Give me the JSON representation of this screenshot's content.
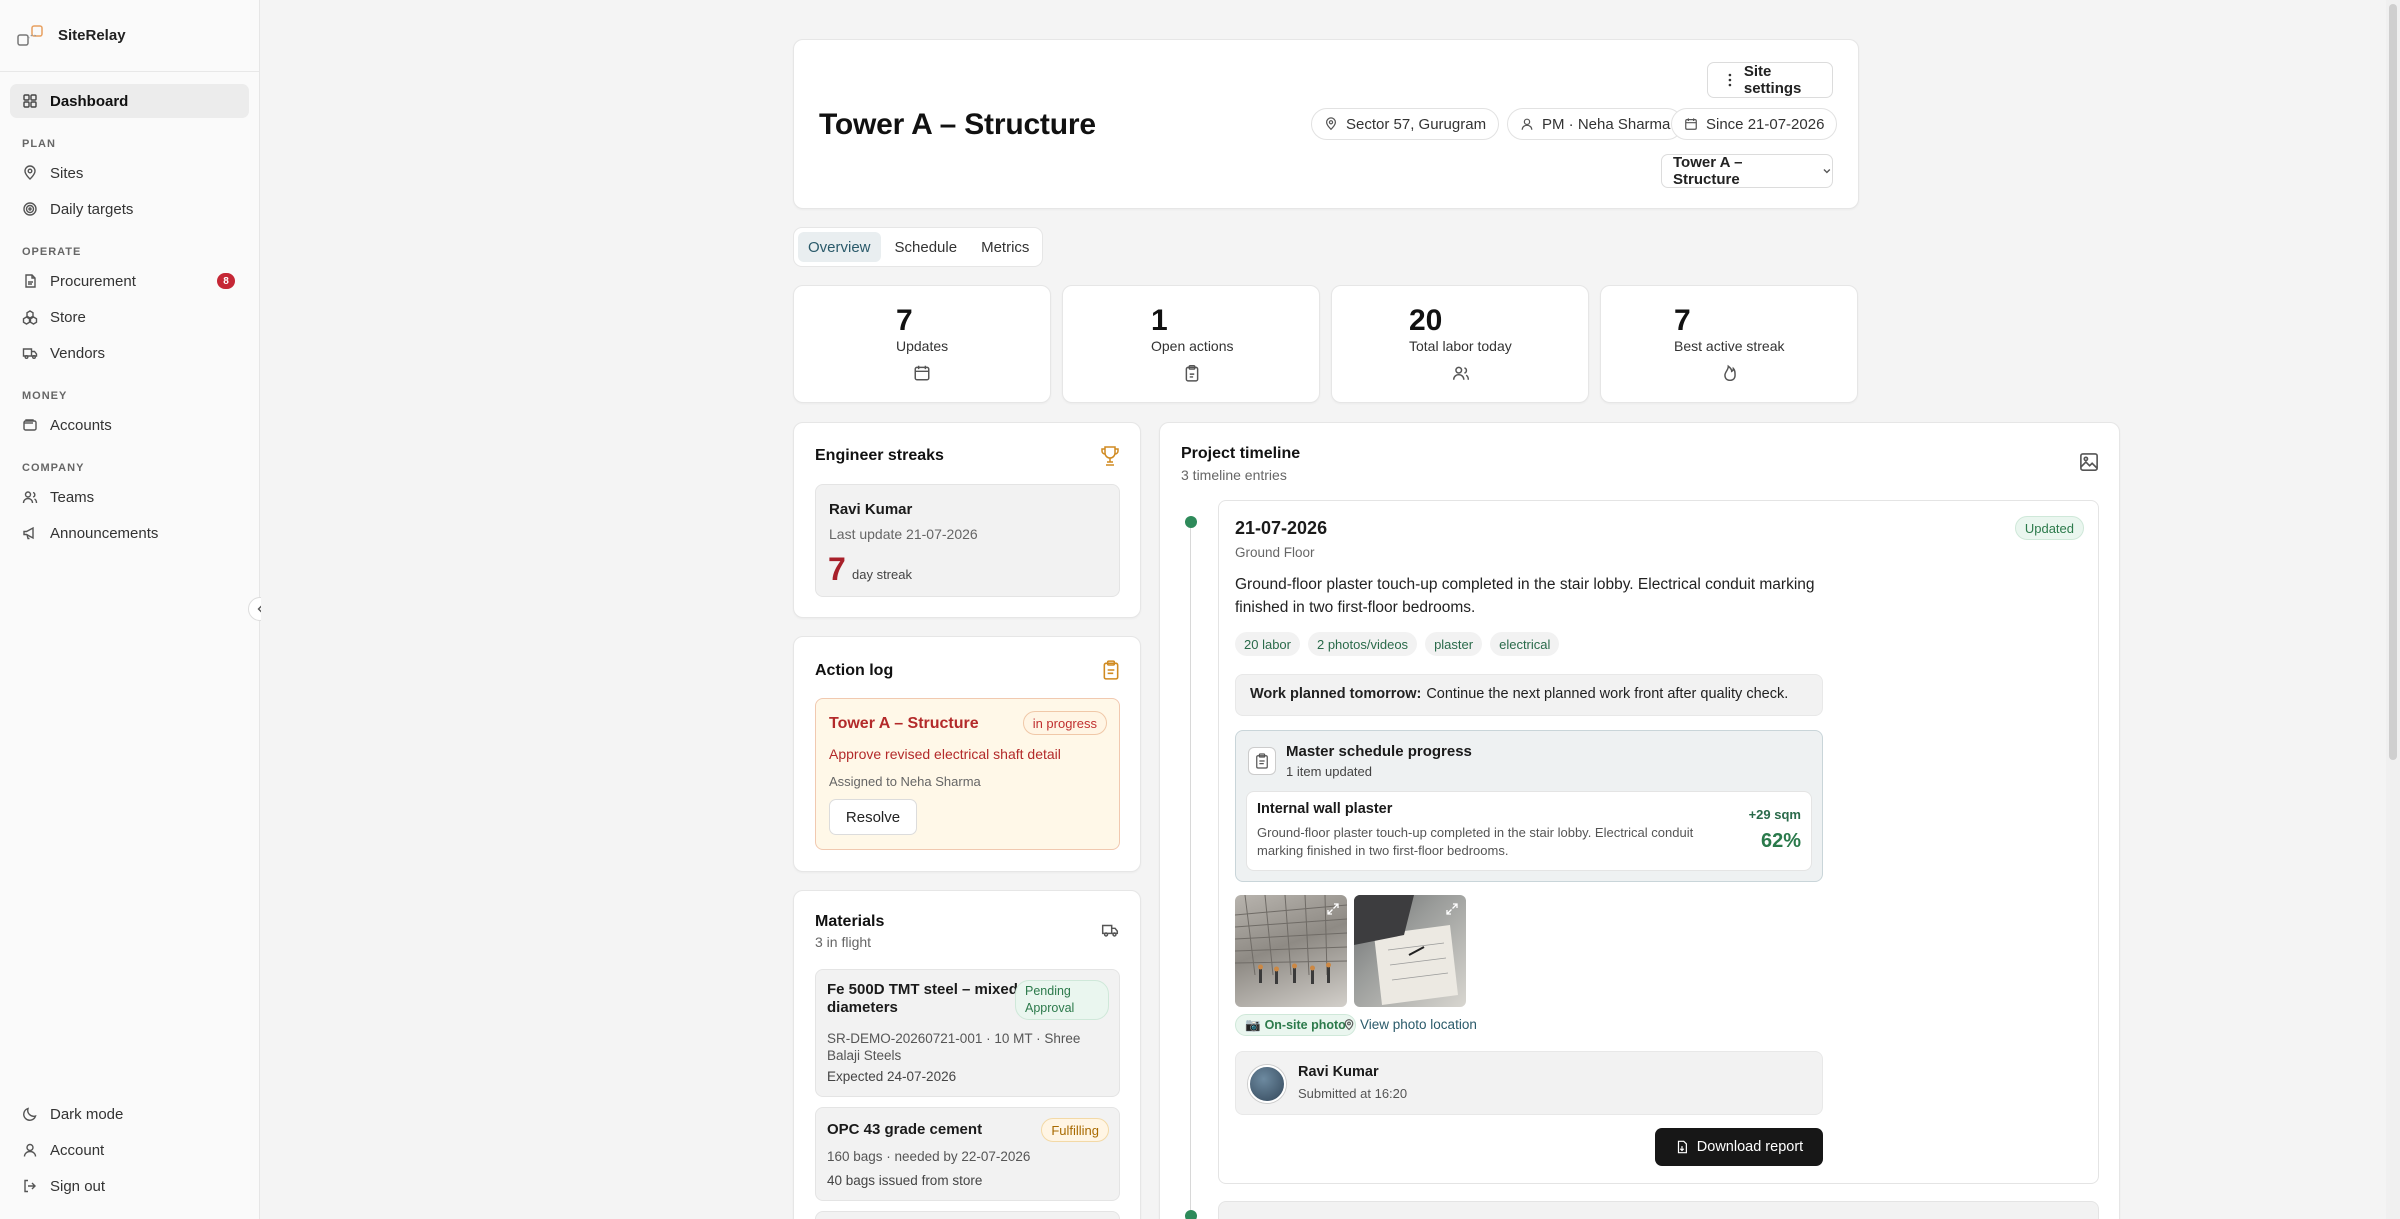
{
  "app": {
    "name": "SiteRelay"
  },
  "sidebar": {
    "dashboard": "Dashboard",
    "sections": {
      "plan": "PLAN",
      "operate": "OPERATE",
      "money": "MONEY",
      "company": "COMPANY"
    },
    "items": {
      "sites": "Sites",
      "daily_targets": "Daily targets",
      "procurement": "Procurement",
      "procurement_badge": "8",
      "store": "Store",
      "vendors": "Vendors",
      "accounts": "Accounts",
      "teams": "Teams",
      "announcements": "Announcements"
    },
    "bottom": {
      "dark_mode": "Dark mode",
      "account": "Account",
      "sign_out": "Sign out"
    }
  },
  "header": {
    "title": "Tower A – Structure",
    "site_settings": "Site settings",
    "location": "Sector 57, Gurugram",
    "pm": "PM · Neha Sharma",
    "since": "Since 21-07-2026",
    "site_select": "Tower A – Structure"
  },
  "tabs": [
    "Overview",
    "Schedule",
    "Metrics"
  ],
  "stats": [
    {
      "value": "7",
      "label": "Updates"
    },
    {
      "value": "1",
      "label": "Open actions"
    },
    {
      "value": "20",
      "label": "Total labor today"
    },
    {
      "value": "7",
      "label": "Best active streak"
    }
  ],
  "streaks": {
    "title": "Engineer streaks",
    "name": "Ravi Kumar",
    "last_update": "Last update 21-07-2026",
    "days": "7",
    "days_label": "day streak"
  },
  "action_log": {
    "title": "Action log",
    "item_title": "Tower A – Structure",
    "status": "in progress",
    "description": "Approve revised electrical shaft detail",
    "assigned": "Assigned to Neha Sharma",
    "resolve": "Resolve"
  },
  "materials": {
    "title": "Materials",
    "subtitle": "3 in flight",
    "items": [
      {
        "name": "Fe 500D TMT steel – mixed diameters",
        "status": "Pending Approval",
        "meta": "SR-DEMO-20260721-001 · 10 MT · Shree Balaji Steels",
        "expected": "Expected 24-07-2026"
      },
      {
        "name": "OPC 43 grade cement",
        "status": "Fulfilling",
        "meta": "160 bags · needed by 22-07-2026",
        "expected": "40 bags issued from store"
      }
    ]
  },
  "timeline": {
    "title": "Project timeline",
    "subtitle": "3 timeline entries",
    "entry": {
      "date": "21-07-2026",
      "floor": "Ground Floor",
      "status": "Updated",
      "text": "Ground-floor plaster touch-up completed in the stair lobby. Electrical conduit marking finished in two first-floor bedrooms.",
      "tags": [
        "20 labor",
        "2 photos/videos",
        "plaster",
        "electrical"
      ],
      "planned_label": "Work planned tomorrow:",
      "planned_text": "Continue the next planned work front after quality check.",
      "schedule_title": "Master schedule progress",
      "schedule_sub": "1 item updated",
      "item_title": "Internal wall plaster",
      "item_text": "Ground-floor plaster touch-up completed in the stair lobby. Electrical conduit marking finished in two first-floor bedrooms.",
      "item_delta": "+29 sqm",
      "item_percent": "62%",
      "photo_tag": "On-site photo",
      "photo_location": "View photo location",
      "submitter": "Ravi Kumar",
      "submitted": "Submitted at 16:20",
      "download": "Download report"
    }
  }
}
